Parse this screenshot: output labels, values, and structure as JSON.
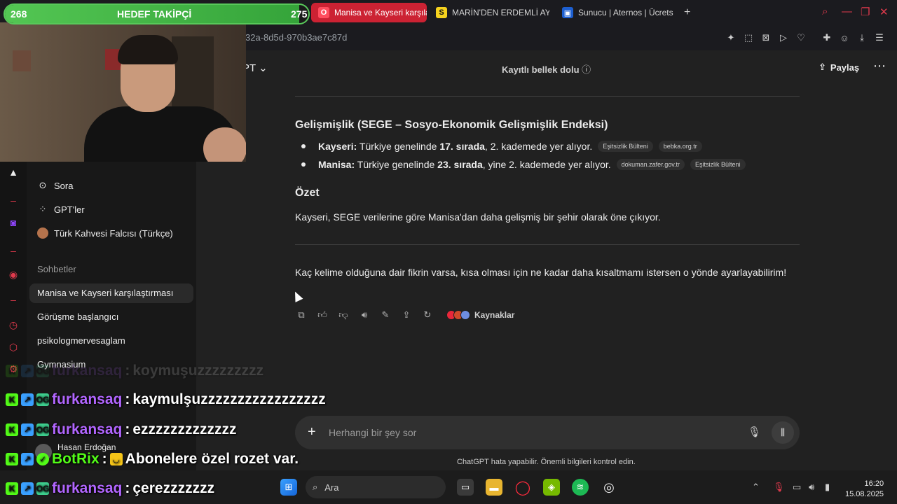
{
  "browser": {
    "tabs": [
      {
        "label": "Manisa ve Kayseri karşıla",
        "active": true,
        "icon": "opera-icon"
      },
      {
        "label": "MARİN'DEN ERDEMLİ AY",
        "active": false,
        "icon": "s-icon"
      },
      {
        "label": "Sunucu | Aternos | Ücrets",
        "active": false,
        "icon": "aternos-icon"
      }
    ],
    "new_tab": "+",
    "url": "32a-8d5d-970b3ae7c87d"
  },
  "header": {
    "model": "PT",
    "memory_status": "Kayıtlı bellek dolu",
    "share_label": "Paylaş"
  },
  "sidebar": {
    "items": [
      {
        "label": "Sora",
        "icon": "play-circle-icon"
      },
      {
        "label": "GPT'ler",
        "icon": "grid-icon"
      },
      {
        "label": "Türk Kahvesi Falcısı (Türkçe)",
        "icon": "coffee-avatar-icon"
      }
    ],
    "section_title": "Sohbetler",
    "chats": [
      {
        "label": "Manisa ve Kayseri karşılaştırması",
        "selected": true
      },
      {
        "label": "Görüşme başlangıcı",
        "selected": false
      },
      {
        "label": "psikologmervesaglam",
        "selected": false
      },
      {
        "label": "Gymnasium",
        "selected": false
      }
    ],
    "user": "Hasan Erdoğan"
  },
  "content": {
    "heading1": "Gelişmişlik (SEGE – Sosyo-Ekonomik Gelişmişlik Endeksi)",
    "bullets": [
      {
        "bold": "Kayseri:",
        "text1": " Türkiye genelinde ",
        "rank": "17. sırada",
        "text2": ", 2. kademede yer alıyor.",
        "chips": [
          "Eşitsizlik Bülteni",
          "bebka.org.tr"
        ]
      },
      {
        "bold": "Manisa:",
        "text1": " Türkiye genelinde ",
        "rank": "23. sırada",
        "text2": ", yine 2. kademede yer alıyor.",
        "chips": [
          "dokuman.zafer.gov.tr",
          "Eşitsizlik Bülteni"
        ]
      }
    ],
    "heading2": "Özet",
    "summary": "Kayseri, SEGE verilerine göre Manisa'dan daha gelişmiş bir şehir olarak öne çıkıyor.",
    "followup": "Kaç kelime olduğuna dair fikrin varsa, kısa olması için ne kadar daha kısaltmamı istersen o yönde ayarlayabilirim!",
    "sources_label": "Kaynaklar"
  },
  "composer": {
    "placeholder": "Herhangi bir şey sor",
    "disclaimer": "ChatGPT hata yapabilir. Önemli bilgileri kontrol edin."
  },
  "stream": {
    "goal_title": "HEDEF TAKİPÇİ",
    "goal_current": "268",
    "goal_target": "275",
    "goal_progress": 0.97,
    "chat": [
      {
        "user": "furkansaq",
        "sep": ":",
        "msg": "koymuşuzzzzzzzzz",
        "ghost": true
      },
      {
        "user": "furkansaq",
        "sep": ":",
        "msg": "kaymulşuzzzzzzzzzzzzzzzzz",
        "ghost": false
      },
      {
        "user": "furkansaq",
        "sep": ":",
        "msg": "ezzzzzzzzzzzzz",
        "ghost": false
      },
      {
        "user": "BotRix",
        "sep": ":",
        "msg": "Abonelere özel rozet var.",
        "ghost": false,
        "bot": true
      },
      {
        "user": "furkansaq",
        "sep": ":",
        "msg": "çerezzzzzzz",
        "ghost": false
      }
    ]
  },
  "taskbar": {
    "search_label": "Ara",
    "time": "16:20",
    "date": "15.08.2025"
  },
  "colors": {
    "accent_red": "#cc2233",
    "goal_green": "#53c653",
    "kick_green": "#53fc18",
    "username_purple": "#b266ff"
  }
}
